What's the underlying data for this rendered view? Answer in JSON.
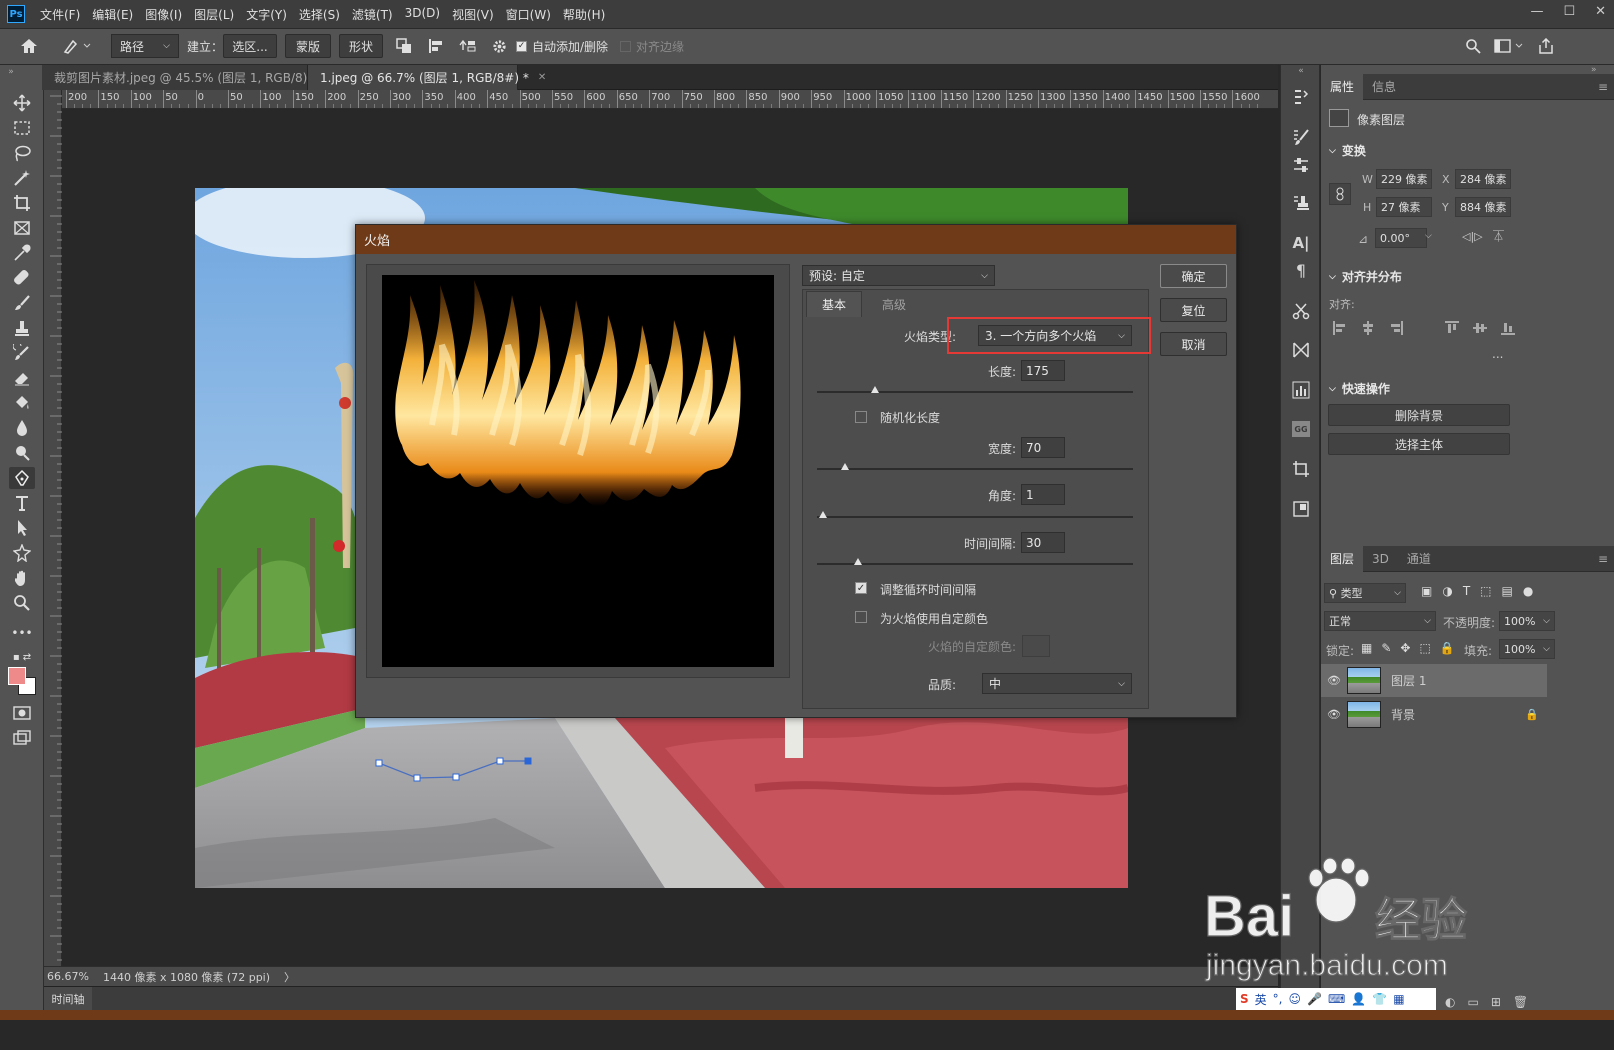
{
  "app": {
    "logo": "Ps"
  },
  "menu": [
    "文件(F)",
    "编辑(E)",
    "图像(I)",
    "图层(L)",
    "文字(Y)",
    "选择(S)",
    "滤镜(T)",
    "3D(D)",
    "视图(V)",
    "窗口(W)",
    "帮助(H)"
  ],
  "options_bar": {
    "path_mode": "路径",
    "create_label": "建立：",
    "selection_btn": "选区...",
    "mask_btn": "蒙版",
    "shape_btn": "形状",
    "auto_add_delete": "自动添加/删除",
    "align_edges": "对齐边缘",
    "auto_add_checked": true,
    "align_edges_checked": false
  },
  "tabs": [
    {
      "label": "裁剪图片素材.jpeg @ 45.5% (图层 1, RGB/8) *",
      "active": false
    },
    {
      "label": "1.jpeg @ 66.7% (图层 1, RGB/8#) *",
      "active": true
    }
  ],
  "ruler_h": [
    "200",
    "150",
    "100",
    "50",
    "0",
    "50",
    "100",
    "150",
    "200",
    "250",
    "300",
    "350",
    "400",
    "450",
    "500",
    "550",
    "600",
    "650",
    "700",
    "750",
    "800",
    "850",
    "900",
    "950",
    "1000",
    "1050",
    "1100",
    "1150",
    "1200",
    "1250",
    "1300",
    "1350",
    "1400",
    "1450",
    "1500",
    "1550",
    "1600"
  ],
  "status": {
    "zoom": "66.67%",
    "doc_info": "1440 像素 x 1080 像素 (72 ppi)",
    "arrow": "〉"
  },
  "timeline": {
    "label": "时间轴"
  },
  "dialog": {
    "title": "火焰",
    "preset_label": "预设: 自定",
    "tabs": [
      "基本",
      "高级"
    ],
    "buttons": {
      "ok": "确定",
      "reset": "复位",
      "cancel": "取消"
    },
    "flame_type_label": "火焰类型:",
    "flame_type_value": "3. 一个方向多个火焰",
    "length_label": "长度:",
    "length_value": "175",
    "randomize_length": "随机化长度",
    "randomize_checked": false,
    "width_label": "宽度:",
    "width_value": "70",
    "angle_label": "角度:",
    "angle_value": "1",
    "interval_label": "时间间隔:",
    "interval_value": "30",
    "adjust_interval": "调整循环时间间隔",
    "adjust_interval_checked": true,
    "custom_color": "为火焰使用自定颜色",
    "custom_color_checked": false,
    "custom_color_label": "火焰的自定颜色:",
    "quality_label": "品质:",
    "quality_value": "中",
    "sliders": {
      "length": 0.165,
      "width": 0.07,
      "angle": 0.0,
      "interval": 0.11
    }
  },
  "properties": {
    "tabs": [
      "属性",
      "信息"
    ],
    "layer_kind": "像素图层",
    "transform_title": "变换",
    "w_label": "W",
    "w_value": "229 像素",
    "h_label": "H",
    "h_value": "27 像素",
    "x_label": "X",
    "x_value": "284 像素",
    "y_label": "Y",
    "y_value": "884 像素",
    "angle_value": "0.00°",
    "align_title": "对齐并分布",
    "align_label": "对齐:",
    "more": "...",
    "quick_title": "快速操作",
    "remove_bg": "删除背景",
    "select_subject": "选择主体"
  },
  "layers_panel": {
    "tabs": [
      "图层",
      "3D",
      "通道"
    ],
    "filter": "类型",
    "blend": "正常",
    "opacity_label": "不透明度:",
    "opacity": "100%",
    "lock_label": "锁定:",
    "fill_label": "填充:",
    "fill": "100%",
    "layers": [
      {
        "name": "图层 1",
        "selected": true,
        "locked": false
      },
      {
        "name": "背景",
        "selected": false,
        "locked": true
      }
    ]
  },
  "watermark": {
    "brand": "Bai",
    "brand2": "经验",
    "url": "jingyan.baidu.com"
  },
  "ime": {
    "lang": "英"
  },
  "colors": {
    "accent_red": "#e53935",
    "title_bar": "#6e3a18",
    "fg_swatch": "#ef8a8a"
  }
}
